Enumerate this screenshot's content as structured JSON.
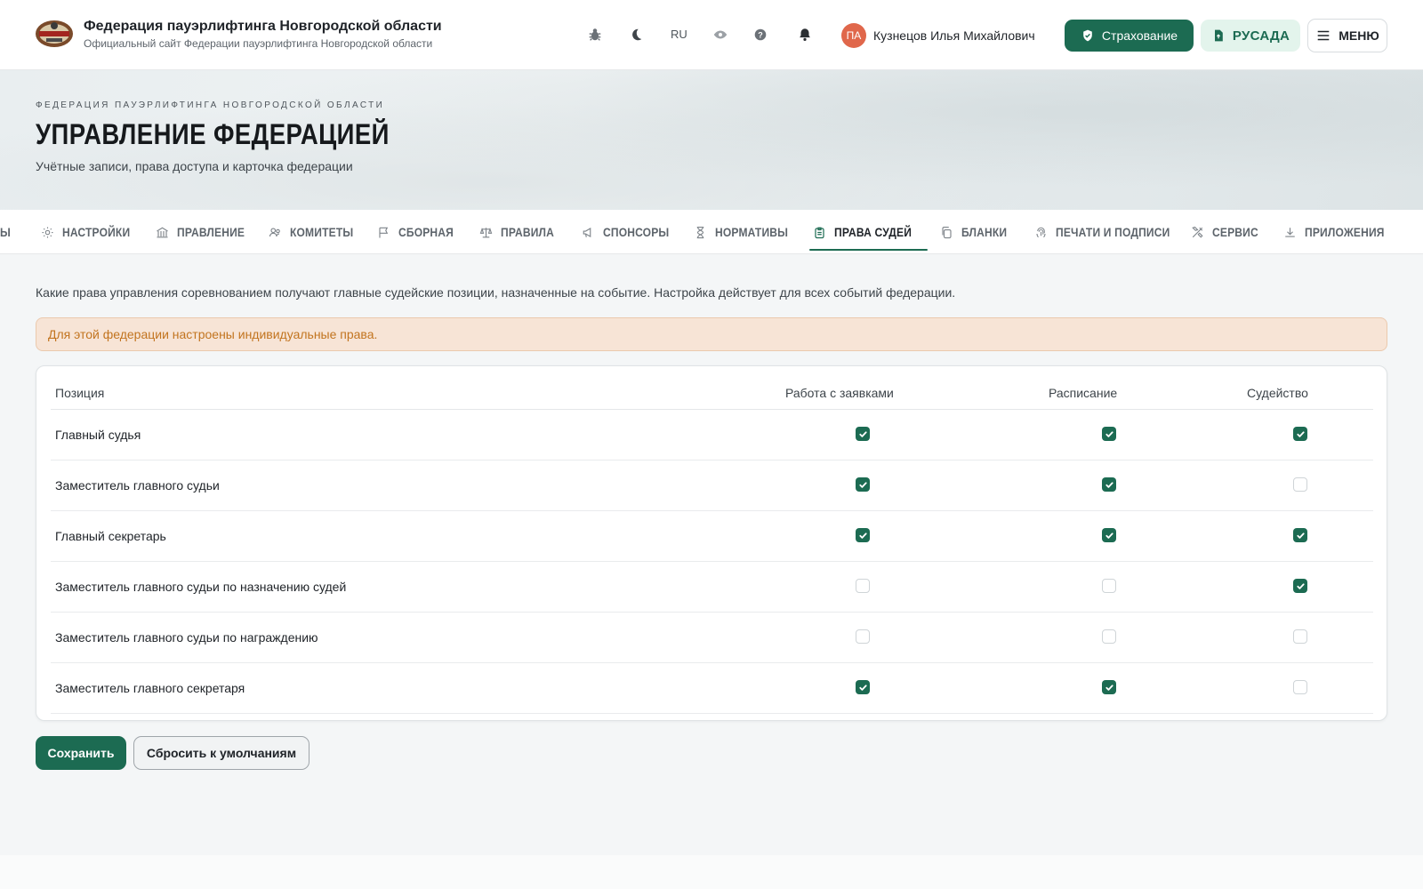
{
  "header": {
    "org_title": "Федерация пауэрлифтинга Новгородской области",
    "org_subtitle": "Официальный сайт Федерации пауэрлифтинга Новгородской области",
    "lang": "RU",
    "user_initials": "ПА",
    "user_name": "Кузнецов Илья Михайлович",
    "insurance_label": "Страхование",
    "rusada_label": "РУСАДА",
    "menu_label": "МЕНЮ"
  },
  "hero": {
    "eyebrow": "ФЕДЕРАЦИЯ ПАУЭРЛИФТИНГА НОВГОРОДСКОЙ ОБЛАСТИ",
    "title": "УПРАВЛЕНИЕ ФЕДЕРАЦИЕЙ",
    "subtitle": "Учётные записи, права доступа и карточка федерации"
  },
  "tabs": {
    "partial": "Ы",
    "settings": "НАСТРОЙКИ",
    "board": "ПРАВЛЕНИЕ",
    "committees": "КОМИТЕТЫ",
    "team": "СБОРНАЯ",
    "rules": "ПРАВИЛА",
    "sponsors": "СПОНСОРЫ",
    "standards": "НОРМАТИВЫ",
    "judge_rights": "ПРАВА СУДЕЙ",
    "forms": "БЛАНКИ",
    "seals": "ПЕЧАТИ И ПОДПИСИ",
    "service": "СЕРВИС",
    "apps": "ПРИЛОЖЕНИЯ"
  },
  "main": {
    "description": "Какие права управления соревнованием получают главные судейские позиции, назначенные на событие. Настройка действует для всех событий федерации.",
    "alert": "Для этой федерации настроены индивидуальные права.",
    "table": {
      "columns": [
        "Позиция",
        "Работа с заявками",
        "Расписание",
        "Судейство"
      ],
      "rows": [
        {
          "position": "Главный судья",
          "applications": true,
          "schedule": true,
          "judging": true
        },
        {
          "position": "Заместитель главного судьи",
          "applications": true,
          "schedule": true,
          "judging": false
        },
        {
          "position": "Главный секретарь",
          "applications": true,
          "schedule": true,
          "judging": true
        },
        {
          "position": "Заместитель главного судьи по назначению судей",
          "applications": false,
          "schedule": false,
          "judging": true
        },
        {
          "position": "Заместитель главного судьи по награждению",
          "applications": false,
          "schedule": false,
          "judging": false
        },
        {
          "position": "Заместитель главного секретаря",
          "applications": true,
          "schedule": true,
          "judging": false
        }
      ]
    },
    "save_label": "Сохранить",
    "reset_label": "Сбросить к умолчаниям"
  },
  "colors": {
    "accent": "#1c6b52",
    "alert_bg": "#f7e4d6",
    "alert_text": "#c2741f",
    "avatar": "#e0674b"
  }
}
